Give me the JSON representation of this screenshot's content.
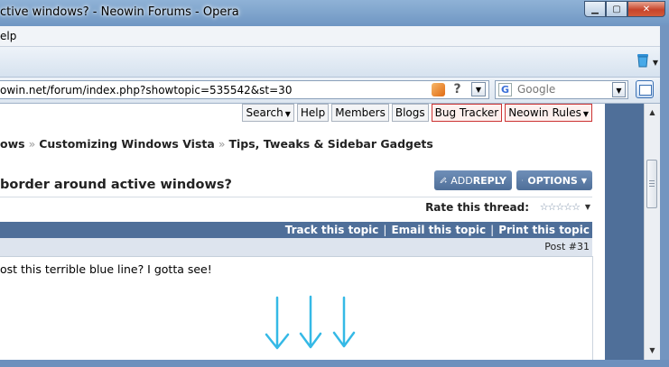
{
  "window": {
    "title": "ctive windows? - Neowin Forums - Opera",
    "minimize": "▁",
    "maximize": "▢",
    "close": "✕"
  },
  "menubar": {
    "help": "elp"
  },
  "addressbar": {
    "url": "owin.net/forum/index.php?showtopic=535542&st=30",
    "help_glyph": "?",
    "search_placeholder": "Google",
    "search_engine_glyph": "G"
  },
  "forum_nav": {
    "buttons": [
      {
        "label": "Search",
        "has_menu": true
      },
      {
        "label": "Help"
      },
      {
        "label": "Members"
      },
      {
        "label": "Blogs"
      },
      {
        "label": "Bug Tracker",
        "highlight": true
      },
      {
        "label": "Neowin Rules",
        "highlight": true,
        "has_menu": true
      }
    ]
  },
  "breadcrumb": {
    "items": [
      "ows",
      "Customizing Windows Vista",
      "Tips, Tweaks & Sidebar Gadgets"
    ],
    "separator": "»"
  },
  "topic": {
    "title": "border around active windows?",
    "add_reply_prefix": "ADD ",
    "add_reply_strong": "REPLY",
    "options_label": "OPTIONS"
  },
  "rating": {
    "label": "Rate this thread:",
    "stars": "☆☆☆☆☆"
  },
  "topic_actions": [
    "Track this topic",
    "Email this topic",
    "Print this topic"
  ],
  "post": {
    "number": "Post #31",
    "text": "ost this terrible blue line? I gotta see!"
  },
  "colors": {
    "forum_blue": "#4f6f99",
    "arrow_cyan": "#35b9e6",
    "highlight_red": "#cc3333"
  }
}
